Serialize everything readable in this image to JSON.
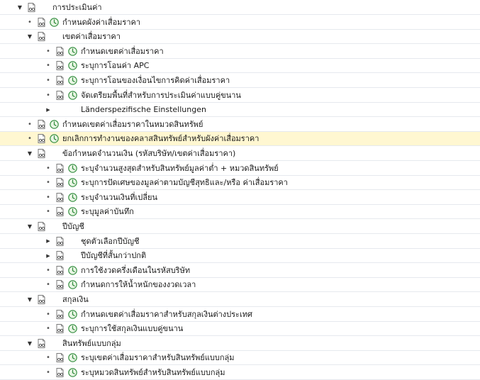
{
  "tree": {
    "rows": [
      {
        "level": 0,
        "toggle": "expanded",
        "exec": false,
        "label": "การประเมินค่า"
      },
      {
        "level": 1,
        "toggle": "leaf",
        "exec": true,
        "label": "กำหนดผังค่าเสื่อมราคา"
      },
      {
        "level": 1,
        "toggle": "expanded",
        "exec": false,
        "label": "เขตค่าเสื่อมราคา"
      },
      {
        "level": 2,
        "toggle": "leaf",
        "exec": true,
        "label": "กำหนดเขตค่าเสื่อมราคา"
      },
      {
        "level": 2,
        "toggle": "leaf",
        "exec": true,
        "label": "ระบุการโอนค่า APC"
      },
      {
        "level": 2,
        "toggle": "leaf",
        "exec": true,
        "label": "ระบุการโอนของเงื่อนไขการคิดค่าเสื่อมราคา"
      },
      {
        "level": 2,
        "toggle": "leaf",
        "exec": true,
        "label": "จัดเตรียมพื้นที่สำหรับการประเมินค่าแบบคู่ขนาน"
      },
      {
        "level": 2,
        "toggle": "collapsed",
        "exec": false,
        "noicon": true,
        "label": "Länderspezifische Einstellungen"
      },
      {
        "level": 1,
        "toggle": "leaf",
        "exec": true,
        "label": "กำหนดเขตค่าเสื่อมราคาในหมวดสินทรัพย์"
      },
      {
        "level": 1,
        "toggle": "leaf",
        "exec": true,
        "label": "ยกเลิกการทำงานของคลาสสินทรัพย์สำหรับผังค่าเสื่อมราคา",
        "highlight": true
      },
      {
        "level": 1,
        "toggle": "expanded",
        "exec": false,
        "label": "ข้อกำหนดจำนวนเงิน (รหัสบริษัท/เขตค่าเสื่อมราคา)"
      },
      {
        "level": 2,
        "toggle": "leaf",
        "exec": true,
        "label": "ระบุจำนวนสูงสุดสำหรับสินทรัพย์มูลค่าต่ำ + หมวดสินทรัพย์"
      },
      {
        "level": 2,
        "toggle": "leaf",
        "exec": true,
        "label": "ระบุการปัดเศษของมูลค่าตามบัญชีสุทธิและ/หรือ ค่าเสื่อมราคา"
      },
      {
        "level": 2,
        "toggle": "leaf",
        "exec": true,
        "label": "ระบุจำนวนเงินที่เปลี่ยน"
      },
      {
        "level": 2,
        "toggle": "leaf",
        "exec": true,
        "label": "ระบุมูลค่าบันทึก"
      },
      {
        "level": 1,
        "toggle": "expanded",
        "exec": false,
        "label": "ปีบัญชี"
      },
      {
        "level": 2,
        "toggle": "collapsed",
        "exec": false,
        "label": "ชุดตัวเลือกปีบัญชี"
      },
      {
        "level": 2,
        "toggle": "collapsed",
        "exec": false,
        "label": "ปีบัญชีที่สั้นกว่าปกติ"
      },
      {
        "level": 2,
        "toggle": "leaf",
        "exec": true,
        "label": "การใช้งวดครึ่งเดือนในรหัสบริษัท"
      },
      {
        "level": 2,
        "toggle": "leaf",
        "exec": true,
        "label": "กำหนดการให้น้ำหนักของงวดเวลา"
      },
      {
        "level": 1,
        "toggle": "expanded",
        "exec": false,
        "label": "สกุลเงิน"
      },
      {
        "level": 2,
        "toggle": "leaf",
        "exec": true,
        "label": "กำหนดเขตค่าเสื่อมราคาสำหรับสกุลเงินต่างประเทศ"
      },
      {
        "level": 2,
        "toggle": "leaf",
        "exec": true,
        "label": "ระบุการใช้สกุลเงินแบบคู่ขนาน"
      },
      {
        "level": 1,
        "toggle": "expanded",
        "exec": false,
        "label": "สินทรัพย์แบบกลุ่ม"
      },
      {
        "level": 2,
        "toggle": "leaf",
        "exec": true,
        "label": "ระบุเขตค่าเสื่อมราคาสำหรับสินทรัพย์แบบกลุ่ม"
      },
      {
        "level": 2,
        "toggle": "leaf",
        "exec": true,
        "label": "ระบุหมวดสินทรัพย์สำหรับสินทรัพย์แบบกลุ่ม"
      }
    ]
  },
  "colors": {
    "highlight": "#fff7d1",
    "exec_icon": "#2e8b3a",
    "doc_icon": "#6b6b6b"
  },
  "icons": {
    "doc": "document-glasses-icon",
    "exec": "execute-clock-icon",
    "expanded": "triangle-down-icon",
    "collapsed": "triangle-right-icon",
    "leaf": "bullet-icon"
  }
}
